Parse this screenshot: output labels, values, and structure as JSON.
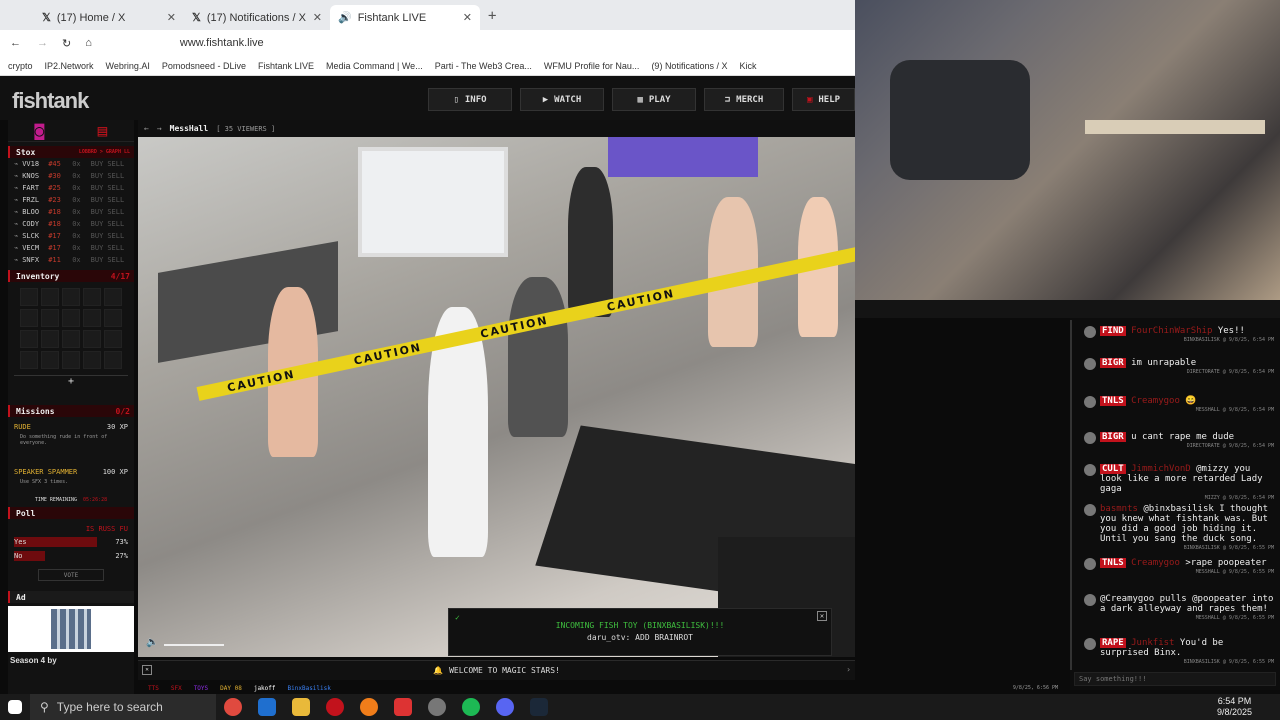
{
  "browser": {
    "tabs": [
      {
        "label": "(17) Home / X",
        "icon": "x-icon"
      },
      {
        "label": "(17) Notifications / X",
        "icon": "x-icon"
      },
      {
        "label": "Fishtank LIVE",
        "icon": "speaker-icon"
      }
    ],
    "url": "www.fishtank.live",
    "bookmarks": [
      "crypto",
      "IP2.Network",
      "Webring.AI",
      "Pomodsneed - DLive",
      "Fishtank LIVE",
      "Media Command | We...",
      "Parti - The Web3 Crea...",
      "WFMU Profile for Nau...",
      "(9) Notifications / X",
      "Kick"
    ]
  },
  "site": {
    "logo": "fishtank",
    "nav": [
      "INFO",
      "WATCH",
      "PLAY",
      "MERCH",
      "HELP"
    ]
  },
  "stox": {
    "title": "Stox",
    "header_right": "LOBBRD > GRAPH LL",
    "rows": [
      {
        "name": "VV18",
        "price": "#45"
      },
      {
        "name": "KNOS",
        "price": "#30"
      },
      {
        "name": "FART",
        "price": "#25"
      },
      {
        "name": "FRZL",
        "price": "#23"
      },
      {
        "name": "BLOO",
        "price": "#18"
      },
      {
        "name": "CODY",
        "price": "#18"
      },
      {
        "name": "SLCK",
        "price": "#17"
      },
      {
        "name": "VECM",
        "price": "#17"
      },
      {
        "name": "SNFX",
        "price": "#11"
      }
    ],
    "count_label": "0x",
    "buy": "BUY",
    "sell": "SELL"
  },
  "inventory": {
    "title": "Inventory",
    "count": "4/17",
    "add": "+"
  },
  "missions": {
    "title": "Missions",
    "count": "0/2",
    "items": [
      {
        "name": "RUDE",
        "xp": "30 XP",
        "desc": "Do something rude in front of everyone."
      },
      {
        "name": "SPEAKER SPAMMER",
        "xp": "100 XP",
        "desc": "Use SFX 3 times."
      }
    ],
    "time_label": "TIME REMAINING",
    "time_value": "05:26:28"
  },
  "poll": {
    "title": "Poll",
    "question": "IS RUSS FU",
    "options": [
      {
        "label": "Yes",
        "pct": "73%",
        "value": 0.73
      },
      {
        "label": "No",
        "pct": "27%",
        "value": 0.27
      }
    ],
    "vote": "VOTE"
  },
  "ad": {
    "title": "Ad",
    "caption": "Season 4 by"
  },
  "room": {
    "name": "MessHall",
    "viewers": "[ 35 VIEWERS ]"
  },
  "video_overlay": {
    "tape": "CAUTION"
  },
  "toast": {
    "line1": "INCOMING FISH TOY (BINXBASILISK)!!!",
    "line2": "daru_otv: ADD BRAINROT"
  },
  "banner": "WELCOME TO MAGIC STARS!",
  "bottom_strip": {
    "user1": "jakoff",
    "user2": "BinxBasilisk",
    "day": "DAY 08",
    "date": "9/8/25, 6:56 PM"
  },
  "chat": {
    "messages": [
      {
        "tag": "FIND",
        "user": "FourChinWarShip",
        "text": "Yes!!",
        "meta": "BINXBASILISK @ 9/8/25, 6:54 PM"
      },
      {
        "tag": "BIGR",
        "user": "",
        "text": "im unrapable",
        "meta": "DIRECTORATE @ 9/8/25, 6:54 PM"
      },
      {
        "tag": "TNLS",
        "user": "Creamygoo",
        "text": "😄",
        "meta": "MESSHALL @ 9/8/25, 6:54 PM"
      },
      {
        "tag": "BIGR",
        "user": "",
        "text": "u cant rape me dude",
        "meta": "DIRECTORATE @ 9/8/25, 6:54 PM"
      },
      {
        "tag": "CULT",
        "user": "JimmichVonD",
        "text": "@mizzy you look like a more retarded Lady gaga",
        "meta": "MIZZY @ 9/8/25, 6:54 PM"
      },
      {
        "tag": "",
        "user": "basmnts",
        "text": "@binxbasilisk I thought you knew what fishtank was. But you did a good job hiding it. Until you sang the duck song.",
        "meta": "BINXBASILISK @ 9/8/25, 6:55 PM"
      },
      {
        "tag": "TNLS",
        "user": "Creamygoo",
        "text": ">rape poopeater",
        "meta": "MESSHALL @ 9/8/25, 6:55 PM"
      },
      {
        "tag": "",
        "user": "",
        "text": "@Creamygoo pulls @poopeater into a dark alleyway and rapes them!",
        "meta": "MESSHALL @ 9/8/25, 6:55 PM"
      },
      {
        "tag": "RAPE",
        "user": "Junkfist",
        "text": "You'd be surprised Binx.",
        "meta": "BINXBASILISK @ 9/8/25, 6:55 PM"
      }
    ],
    "placeholder": "Say something!!!"
  },
  "taskbar": {
    "search": "Type here to search",
    "time": "6:54 PM",
    "date": "9/8/2025"
  }
}
